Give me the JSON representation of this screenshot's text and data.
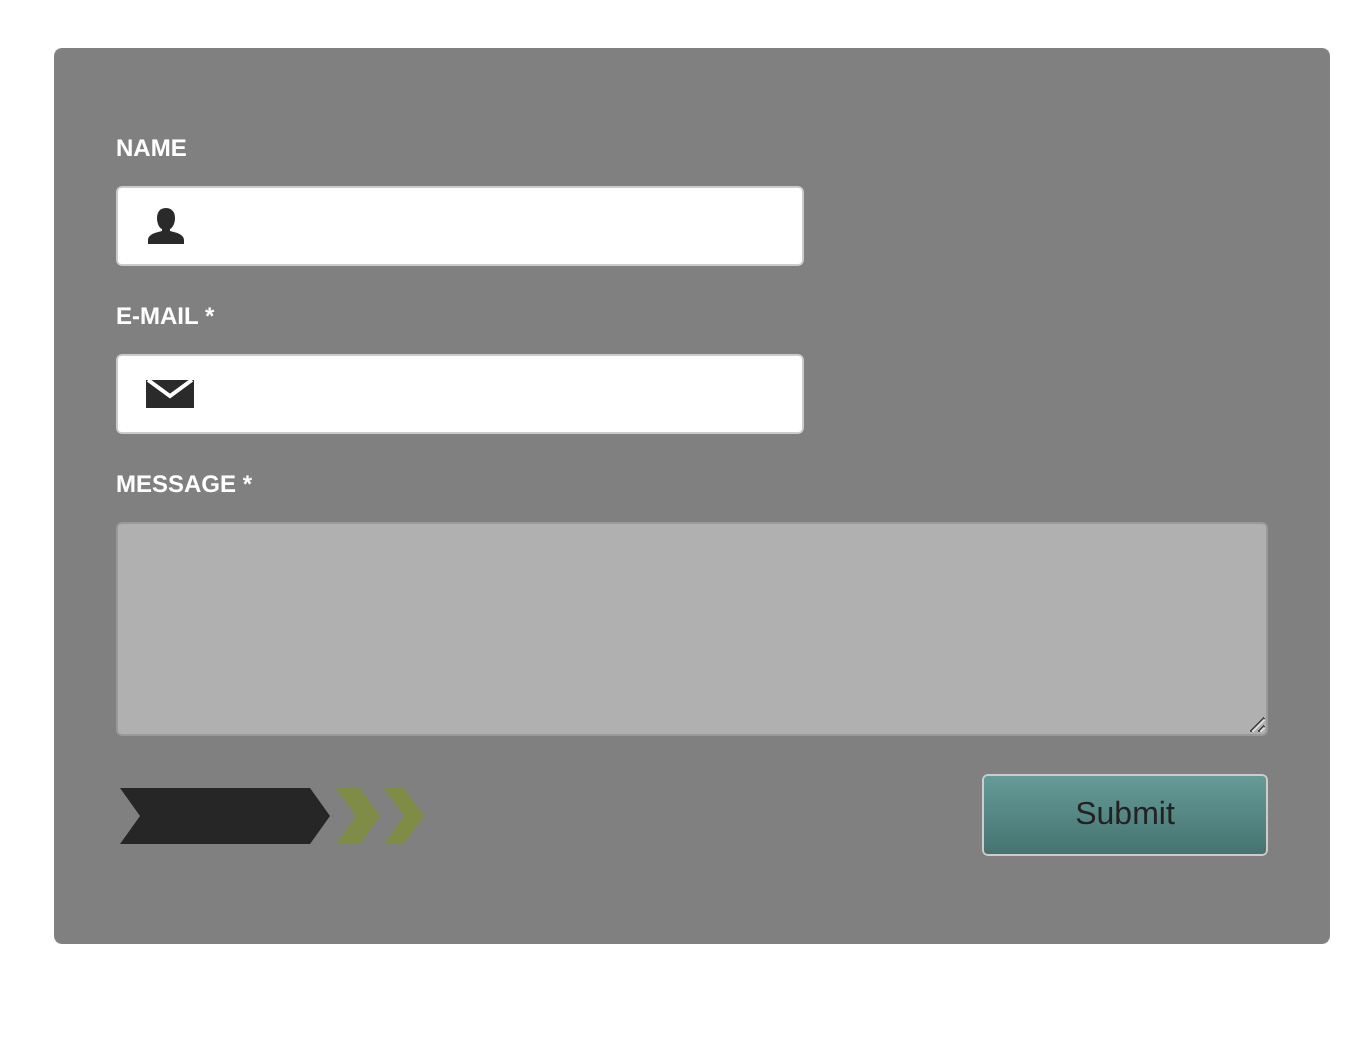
{
  "form": {
    "fields": [
      {
        "label": "NAME",
        "kind": "name"
      },
      {
        "label": "E-MAIL *",
        "kind": "email"
      },
      {
        "label": "MESSAGE *",
        "kind": "message"
      }
    ],
    "submit": "Submit"
  }
}
